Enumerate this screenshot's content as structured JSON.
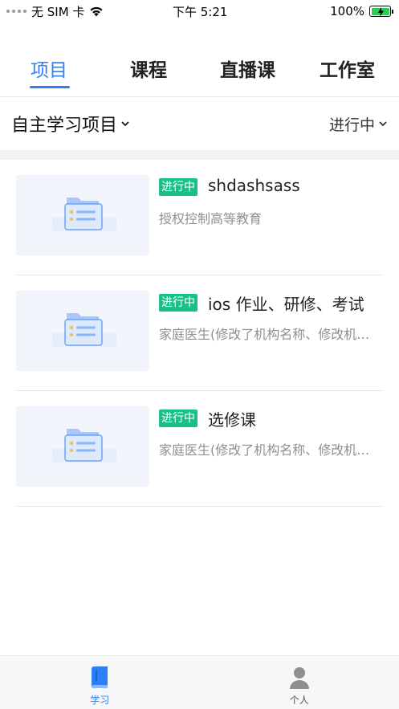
{
  "status_bar": {
    "carrier": "无 SIM 卡",
    "time": "下午 5:21",
    "battery": "100%"
  },
  "tabs": [
    {
      "label": "项目",
      "active": true
    },
    {
      "label": "课程",
      "active": false
    },
    {
      "label": "直播课",
      "active": false
    },
    {
      "label": "工作室",
      "active": false
    }
  ],
  "filter": {
    "category": "自主学习项目",
    "status": "进行中"
  },
  "items": [
    {
      "badge": "进行中",
      "title": "shdashsass",
      "subtitle": "授权控制高等教育"
    },
    {
      "badge": "进行中",
      "title": "ios 作业、研修、考试",
      "subtitle": "家庭医生(修改了机构名称、修改机构名称"
    },
    {
      "badge": "进行中",
      "title": "选修课",
      "subtitle": "家庭医生(修改了机构名称、修改机构名称"
    }
  ],
  "bottom_nav": [
    {
      "label": "学习",
      "icon": "book-icon",
      "active": true
    },
    {
      "label": "个人",
      "icon": "person-icon",
      "active": false
    }
  ],
  "colors": {
    "accent": "#2d7ff9",
    "badge": "#1bbf8a",
    "battery": "#34c759"
  }
}
